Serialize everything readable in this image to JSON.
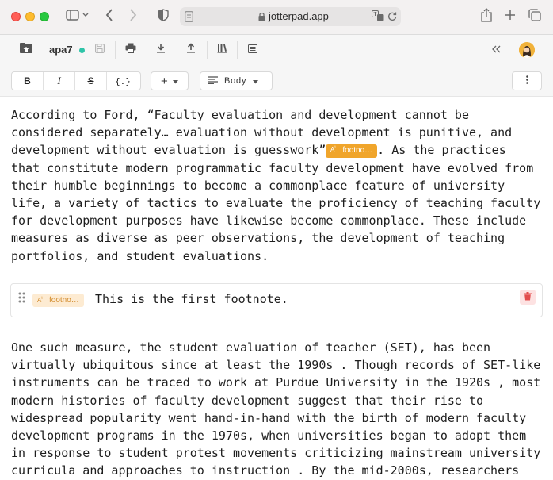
{
  "browser": {
    "url": "jotterpad.app"
  },
  "toolbar": {
    "doc_name": "apa7"
  },
  "format": {
    "bold": "B",
    "italic": "I",
    "strike": "S",
    "code": "{.}",
    "insert": "+",
    "style_label": "Body"
  },
  "document": {
    "para1": [
      "According to Ford, “Faculty evaluation and development cannot be",
      "considered separately… evaluation without development is punitive, and",
      "development without evaluation is guesswork”",
      "that constitute modern programmatic faculty development have evolved from",
      "their humble beginnings to become a commonplace feature of university",
      "life, a variety of tactics to evaluate the proficiency of teaching faculty",
      "for development purposes have likewise become commonplace. These include",
      "measures as diverse as peer observations, the development of teaching",
      "portfolios, and student evaluations."
    ],
    "para1_line3_tail": ". As the practices",
    "footnote_chip": "footno…",
    "footnote_text": "This is the first footnote.",
    "para2": [
      "One such measure, the student evaluation of teacher (SET), has been",
      "virtually ubiquitous since at least the 1990s . Though records of SET-like",
      "instruments can be traced to work at Purdue University in the 1920s , most",
      "modern histories of faculty development suggest that their rise to",
      "widespread popularity went hand-in-hand with the birth of modern faculty",
      "development programs in the 1970s, when universities began to adopt them",
      "in response to student protest movements criticizing mainstream university",
      "curricula and approaches to instruction . By the mid-2000s, researchers"
    ]
  },
  "colors": {
    "status_dot": "#2ec4a8",
    "chip": "#f0a52b",
    "delete": "#e24d4d"
  }
}
